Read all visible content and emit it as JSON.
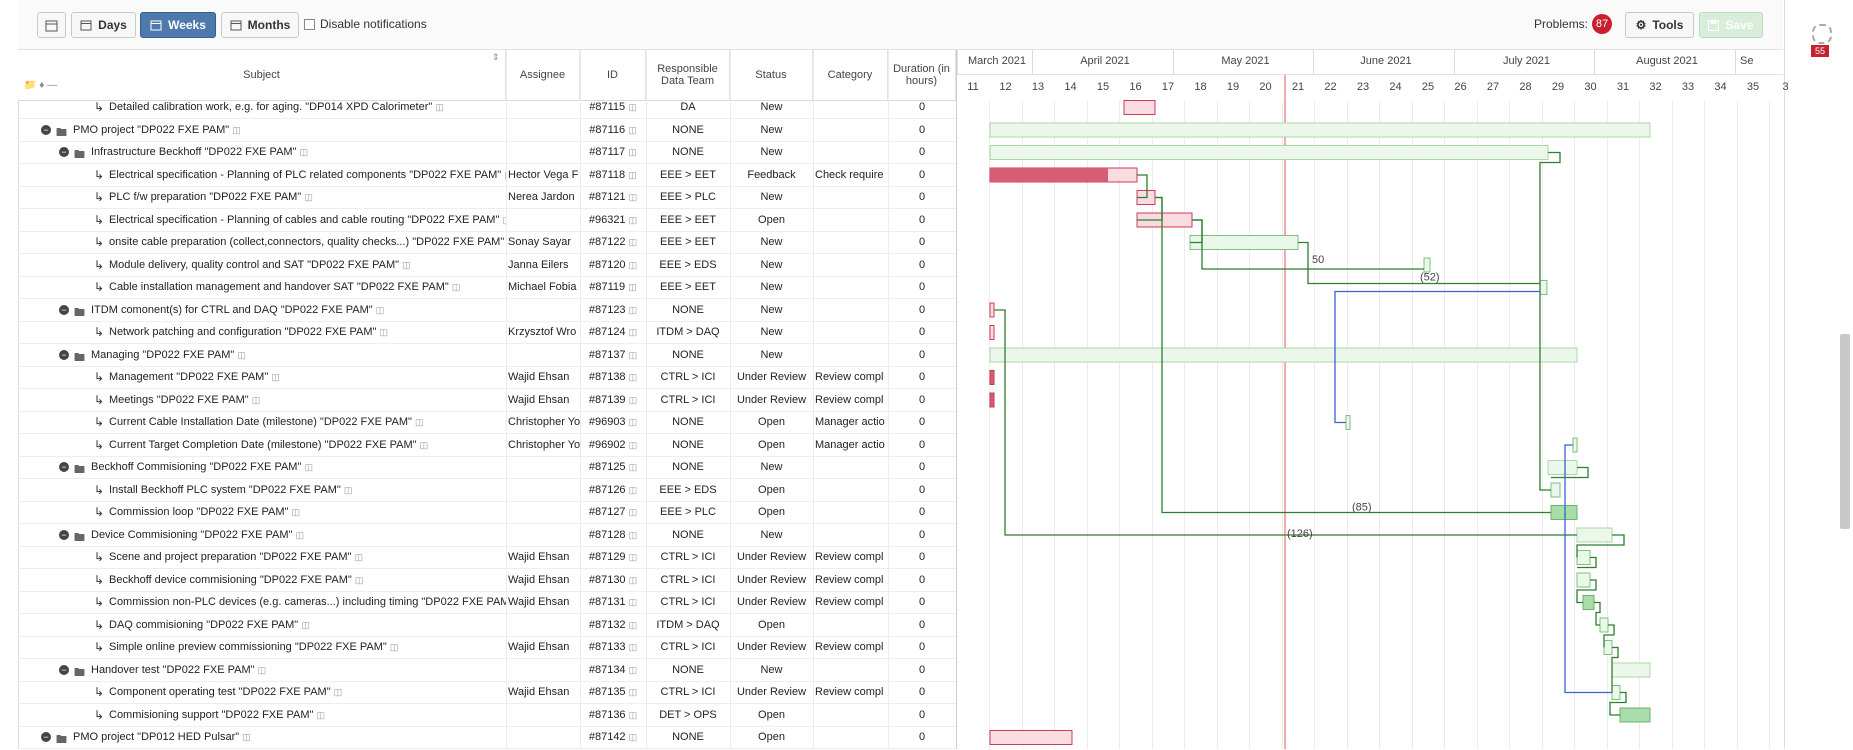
{
  "toolbar": {
    "days_label": "Days",
    "weeks_label": "Weeks",
    "months_label": "Months",
    "disable_notifications_label": "Disable notifications",
    "problems_label": "Problems:",
    "problems_count": "87",
    "tools_label": "Tools",
    "save_label": "Save"
  },
  "columns": {
    "subject": "Subject",
    "assignee": "Assignee",
    "id": "ID",
    "team": "Responsible Data Team",
    "status": "Status",
    "category": "Category",
    "duration": "Duration (in hours)"
  },
  "timeline": {
    "months": [
      "March 2021",
      "April 2021",
      "May 2021",
      "June 2021",
      "July 2021",
      "August 2021",
      "Se"
    ],
    "weeks": [
      "11",
      "12",
      "13",
      "14",
      "15",
      "16",
      "17",
      "18",
      "19",
      "20",
      "21",
      "22",
      "23",
      "24",
      "25",
      "26",
      "27",
      "28",
      "29",
      "30",
      "31",
      "32",
      "33",
      "34",
      "35",
      "3"
    ]
  },
  "rows": [
    {
      "subject": "Detailed calibration work, e.g. for aging. \"DP014 XPD Calorimeter\"",
      "assignee": "",
      "id": "#87115",
      "team": "DA",
      "status": "New",
      "category": "",
      "duration": "0"
    },
    {
      "subject": "PMO project \"DP022 FXE PAM\"",
      "assignee": "",
      "id": "#87116",
      "team": "NONE",
      "status": "New",
      "category": "",
      "duration": "0"
    },
    {
      "subject": "Infrastructure Beckhoff \"DP022 FXE PAM\"",
      "assignee": "",
      "id": "#87117",
      "team": "NONE",
      "status": "New",
      "category": "",
      "duration": "0"
    },
    {
      "subject": "Electrical specification - Planning of PLC related components \"DP022 FXE PAM\"",
      "assignee": "Hector Vega F",
      "id": "#87118",
      "team": "EEE > EET",
      "status": "Feedback",
      "category": "Check require",
      "duration": "0"
    },
    {
      "subject": "PLC f/w preparation \"DP022 FXE PAM\"",
      "assignee": "Nerea Jardon",
      "id": "#87121",
      "team": "EEE > PLC",
      "status": "New",
      "category": "",
      "duration": "0"
    },
    {
      "subject": "Electrical specification - Planning of cables and cable routing \"DP022 FXE PAM\"",
      "assignee": "",
      "id": "#96321",
      "team": "EEE > EET",
      "status": "Open",
      "category": "",
      "duration": "0"
    },
    {
      "subject": "onsite cable preparation (collect,connectors, quality checks...) \"DP022 FXE PAM\"",
      "assignee": "Sonay Sayar",
      "id": "#87122",
      "team": "EEE > EET",
      "status": "New",
      "category": "",
      "duration": "0"
    },
    {
      "subject": "Module delivery, quality control and SAT \"DP022 FXE PAM\"",
      "assignee": "Janna Eilers",
      "id": "#87120",
      "team": "EEE > EDS",
      "status": "New",
      "category": "",
      "duration": "0"
    },
    {
      "subject": "Cable installation management and handover SAT \"DP022 FXE PAM\"",
      "assignee": "Michael Fobia",
      "id": "#87119",
      "team": "EEE > EET",
      "status": "New",
      "category": "",
      "duration": "0"
    },
    {
      "subject": "ITDM comonent(s) for CTRL and DAQ \"DP022 FXE PAM\"",
      "assignee": "",
      "id": "#87123",
      "team": "NONE",
      "status": "New",
      "category": "",
      "duration": "0"
    },
    {
      "subject": "Network patching and configuration \"DP022 FXE PAM\"",
      "assignee": "Krzysztof Wro",
      "id": "#87124",
      "team": "ITDM > DAQ",
      "status": "New",
      "category": "",
      "duration": "0"
    },
    {
      "subject": "Managing \"DP022 FXE PAM\"",
      "assignee": "",
      "id": "#87137",
      "team": "NONE",
      "status": "New",
      "category": "",
      "duration": "0"
    },
    {
      "subject": "Management \"DP022 FXE PAM\"",
      "assignee": "Wajid Ehsan",
      "id": "#87138",
      "team": "CTRL > ICI",
      "status": "Under Review",
      "category": "Review compl",
      "duration": "0"
    },
    {
      "subject": "Meetings \"DP022 FXE PAM\"",
      "assignee": "Wajid Ehsan",
      "id": "#87139",
      "team": "CTRL > ICI",
      "status": "Under Review",
      "category": "Review compl",
      "duration": "0"
    },
    {
      "subject": "Current Cable Installation Date (milestone) \"DP022 FXE PAM\"",
      "assignee": "Christopher Yo",
      "id": "#96903",
      "team": "NONE",
      "status": "Open",
      "category": "Manager actio",
      "duration": "0"
    },
    {
      "subject": "Current Target Completion Date (milestone) \"DP022 FXE PAM\"",
      "assignee": "Christopher Yo",
      "id": "#96902",
      "team": "NONE",
      "status": "Open",
      "category": "Manager actio",
      "duration": "0"
    },
    {
      "subject": "Beckhoff Commisioning \"DP022 FXE PAM\"",
      "assignee": "",
      "id": "#87125",
      "team": "NONE",
      "status": "New",
      "category": "",
      "duration": "0"
    },
    {
      "subject": "Install Beckhoff PLC system \"DP022 FXE PAM\"",
      "assignee": "",
      "id": "#87126",
      "team": "EEE > EDS",
      "status": "Open",
      "category": "",
      "duration": "0"
    },
    {
      "subject": "Commission loop \"DP022 FXE PAM\"",
      "assignee": "",
      "id": "#87127",
      "team": "EEE > PLC",
      "status": "Open",
      "category": "",
      "duration": "0"
    },
    {
      "subject": "Device Commisioning \"DP022 FXE PAM\"",
      "assignee": "",
      "id": "#87128",
      "team": "NONE",
      "status": "New",
      "category": "",
      "duration": "0"
    },
    {
      "subject": "Scene and project preparation \"DP022 FXE PAM\"",
      "assignee": "Wajid Ehsan",
      "id": "#87129",
      "team": "CTRL > ICI",
      "status": "Under Review",
      "category": "Review compl",
      "duration": "0"
    },
    {
      "subject": "Beckhoff device commisioning \"DP022 FXE PAM\"",
      "assignee": "Wajid Ehsan",
      "id": "#87130",
      "team": "CTRL > ICI",
      "status": "Under Review",
      "category": "Review compl",
      "duration": "0"
    },
    {
      "subject": "Commission non-PLC devices (e.g. cameras...) including timing \"DP022 FXE PAM\"",
      "assignee": "Wajid Ehsan",
      "id": "#87131",
      "team": "CTRL > ICI",
      "status": "Under Review",
      "category": "Review compl",
      "duration": "0"
    },
    {
      "subject": "DAQ commisioning \"DP022 FXE PAM\"",
      "assignee": "",
      "id": "#87132",
      "team": "ITDM > DAQ",
      "status": "Open",
      "category": "",
      "duration": "0"
    },
    {
      "subject": "Simple online preview commissioning \"DP022 FXE PAM\"",
      "assignee": "Wajid Ehsan",
      "id": "#87133",
      "team": "CTRL > ICI",
      "status": "Under Review",
      "category": "Review compl",
      "duration": "0"
    },
    {
      "subject": "Handover test \"DP022 FXE PAM\"",
      "assignee": "",
      "id": "#87134",
      "team": "NONE",
      "status": "New",
      "category": "",
      "duration": "0"
    },
    {
      "subject": "Component operating test \"DP022 FXE PAM\"",
      "assignee": "Wajid Ehsan",
      "id": "#87135",
      "team": "CTRL > ICI",
      "status": "Under Review",
      "category": "Review compl",
      "duration": "0"
    },
    {
      "subject": "Commisioning support \"DP022 FXE PAM\"",
      "assignee": "",
      "id": "#87136",
      "team": "DET > OPS",
      "status": "Open",
      "category": "",
      "duration": "0"
    },
    {
      "subject": "PMO project \"DP012 HED Pulsar\"",
      "assignee": "",
      "id": "#87142",
      "team": "NONE",
      "status": "Open",
      "category": "",
      "duration": "0"
    }
  ],
  "gantt_labels": {
    "lag_50": "50",
    "lag_52": "(52)",
    "lag_85": "(85)",
    "lag_126": "(126)"
  },
  "side": {
    "counter": "55"
  },
  "colors": {
    "accent": "#4d79ad",
    "today_line": "#e05a5a",
    "problems_badge": "#c7202f",
    "dependency_green": "#2f7d2f",
    "dependency_blue": "#3a62d6"
  }
}
